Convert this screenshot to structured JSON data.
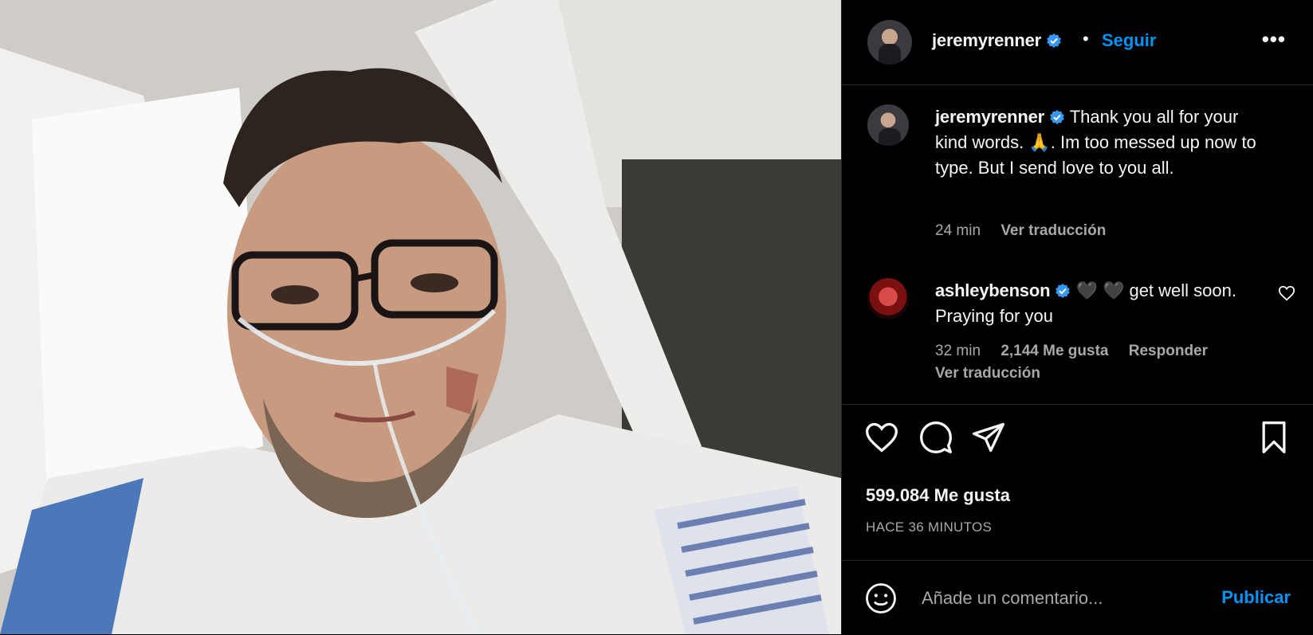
{
  "post": {
    "image": {
      "description_icon": "photo"
    }
  },
  "header": {
    "username": "jeremyrenner",
    "separator": "•",
    "follow_label": "Seguir",
    "more_label": "•••"
  },
  "comments": [
    {
      "username": "jeremyrenner",
      "text": "Thank you all for your kind words. 🙏. Im too messed up now to type. But I send love to you all.",
      "time": "24 min",
      "translate_label": "Ver traducción"
    },
    {
      "username": "ashleybenson",
      "text": "🖤 🖤 get well soon. Praying for you",
      "time": "32 min",
      "likes": "2,144 Me gusta",
      "reply_label": "Responder",
      "translate_label": "Ver traducción"
    }
  ],
  "footer": {
    "likes": "599.084 Me gusta",
    "timestamp": "HACE 36 MINUTOS",
    "comment_placeholder": "Añade un comentario...",
    "publish_label": "Publicar"
  },
  "colors": {
    "accent": "#0095f6",
    "muted": "#a8a8a8",
    "verified": "#3897f0"
  }
}
